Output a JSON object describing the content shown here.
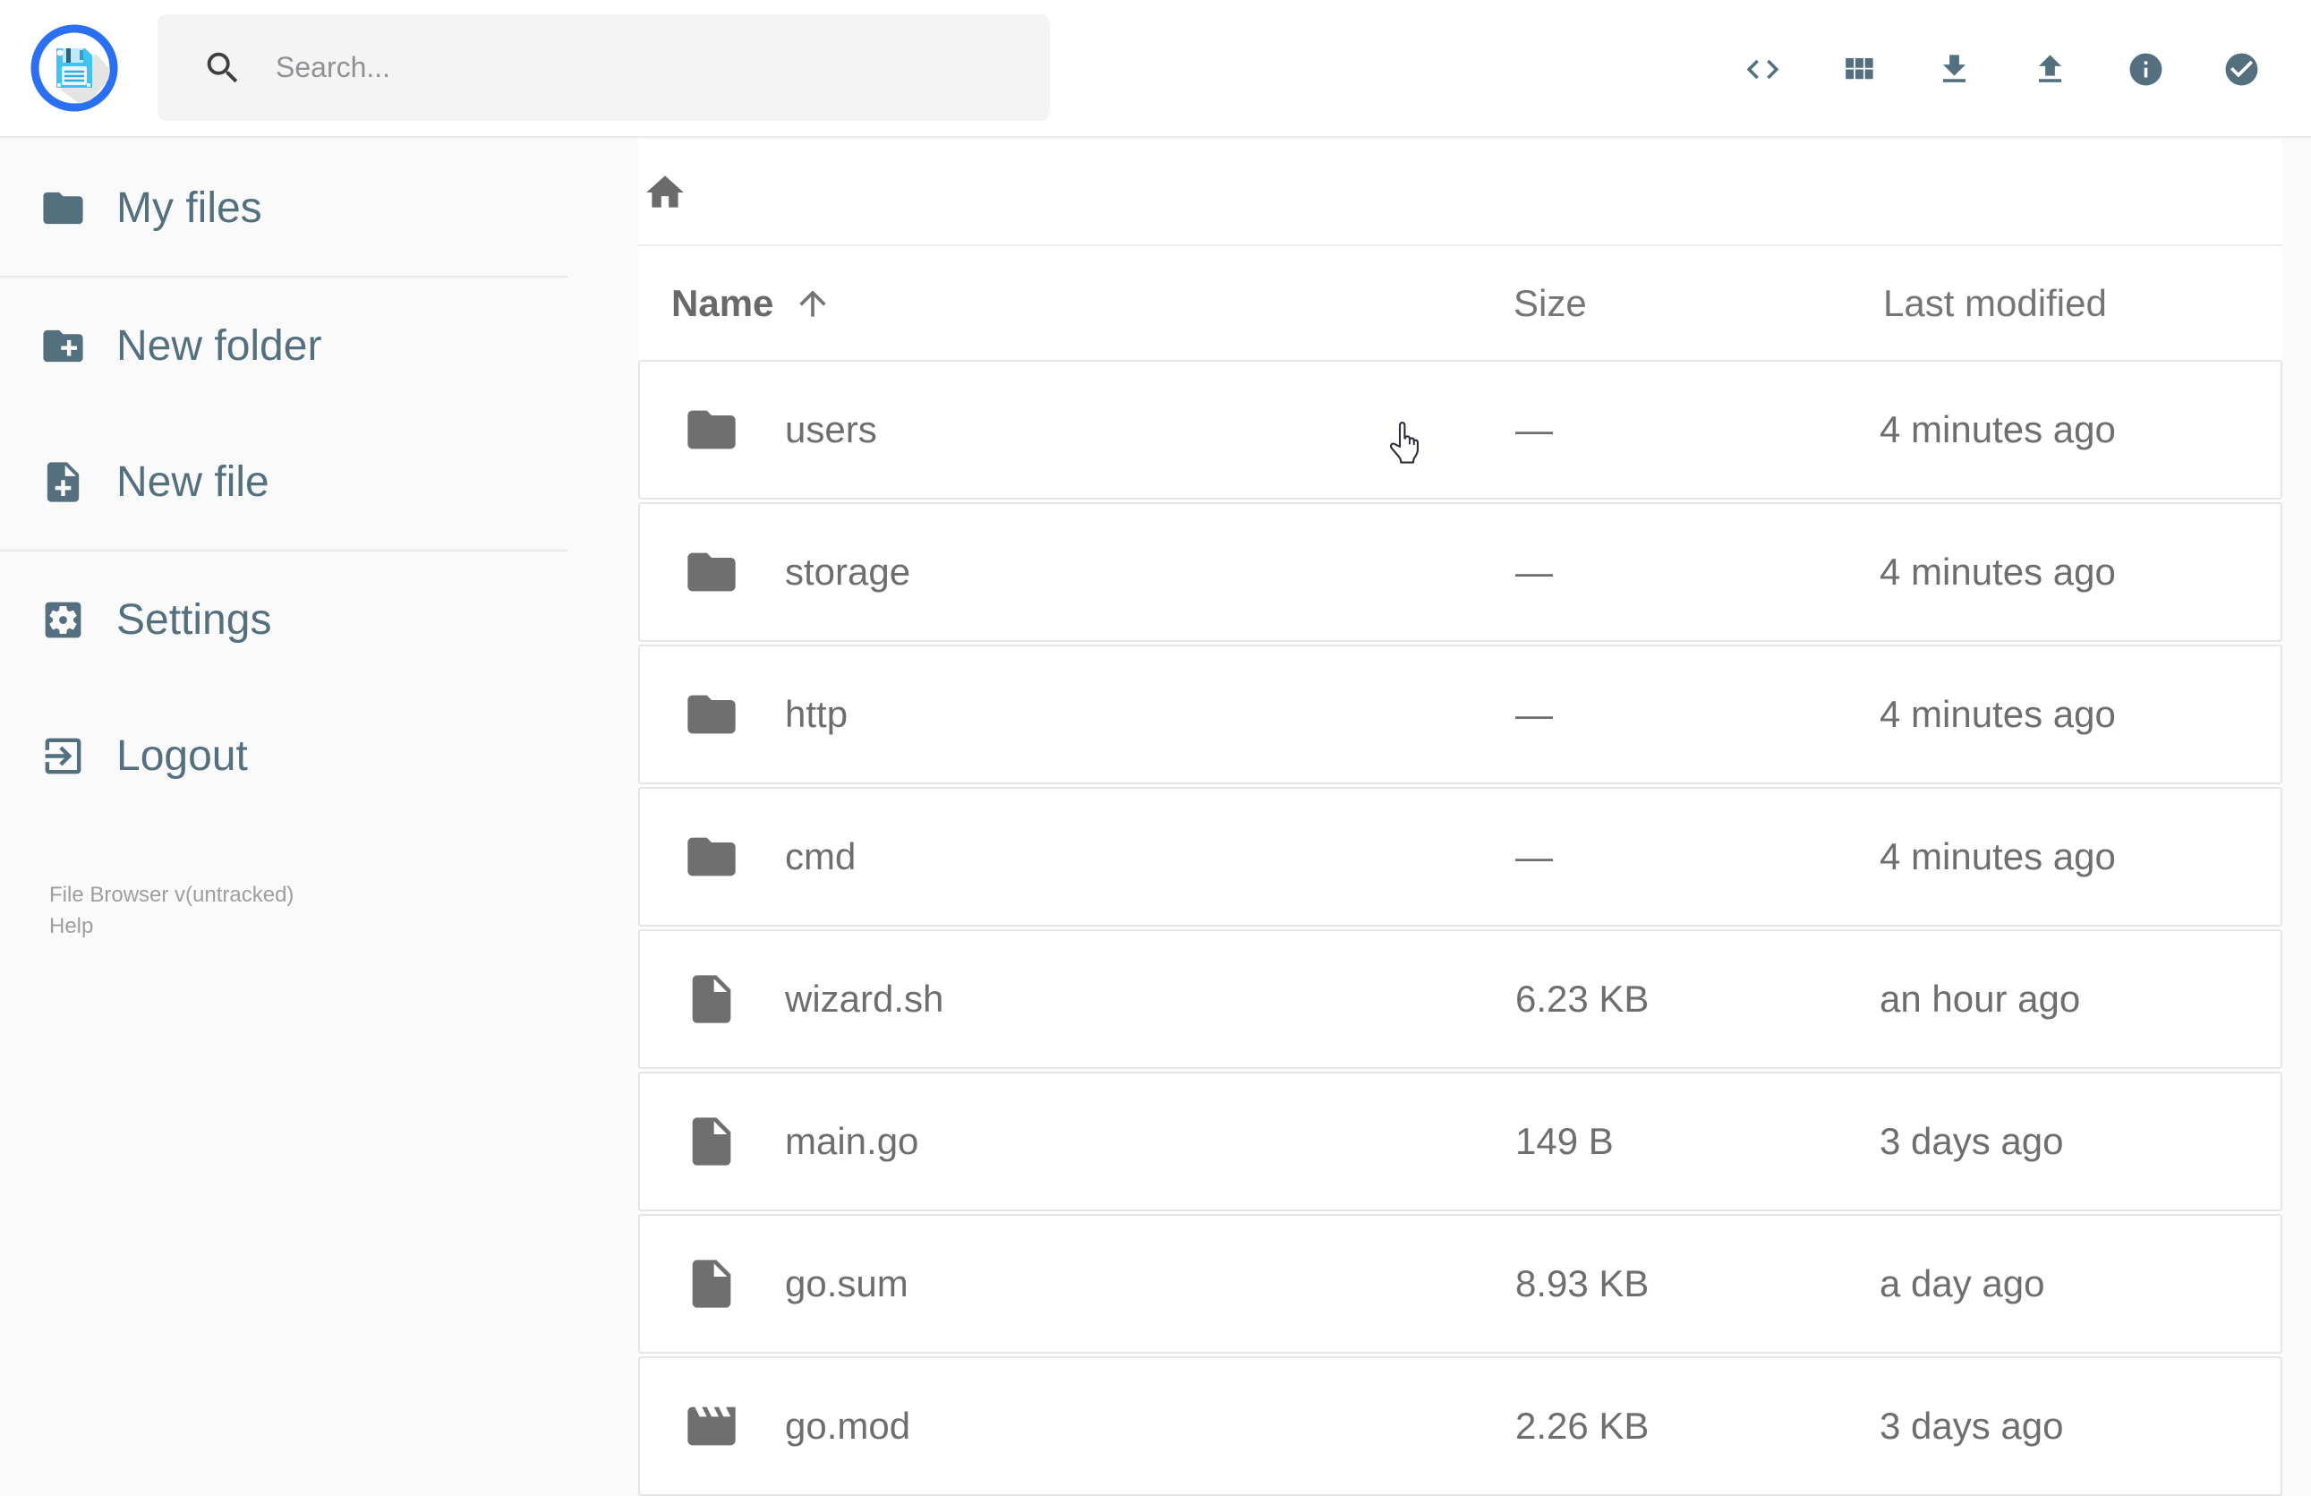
{
  "header": {
    "search": {
      "placeholder": "Search..."
    },
    "actions": [
      {
        "icon": "code-icon"
      },
      {
        "icon": "grid-view-icon"
      },
      {
        "icon": "download-icon"
      },
      {
        "icon": "upload-icon"
      },
      {
        "icon": "info-icon"
      },
      {
        "icon": "check-circle-icon"
      }
    ]
  },
  "sidebar": {
    "items": [
      {
        "label": "My files",
        "icon": "folder-icon"
      },
      {
        "label": "New folder",
        "icon": "folder-plus-icon"
      },
      {
        "label": "New file",
        "icon": "file-plus-icon"
      },
      {
        "label": "Settings",
        "icon": "gear-icon"
      },
      {
        "label": "Logout",
        "icon": "logout-icon"
      }
    ],
    "footer": {
      "version": "File Browser v(untracked)",
      "help": "Help"
    }
  },
  "breadcrumb": {
    "home": "home-icon"
  },
  "listing": {
    "columns": {
      "name": "Name",
      "size": "Size",
      "modified": "Last modified"
    },
    "sort": {
      "column": "name",
      "direction": "asc"
    },
    "rows": [
      {
        "name": "users",
        "type": "folder",
        "size": "—",
        "modified": "4 minutes ago"
      },
      {
        "name": "storage",
        "type": "folder",
        "size": "—",
        "modified": "4 minutes ago"
      },
      {
        "name": "http",
        "type": "folder",
        "size": "—",
        "modified": "4 minutes ago"
      },
      {
        "name": "cmd",
        "type": "folder",
        "size": "—",
        "modified": "4 minutes ago"
      },
      {
        "name": "wizard.sh",
        "type": "file",
        "size": "6.23 KB",
        "modified": "an hour ago"
      },
      {
        "name": "main.go",
        "type": "file",
        "size": "149 B",
        "modified": "3 days ago"
      },
      {
        "name": "go.sum",
        "type": "file",
        "size": "8.93 KB",
        "modified": "a day ago"
      },
      {
        "name": "go.mod",
        "type": "movie",
        "size": "2.26 KB",
        "modified": "3 days ago"
      }
    ]
  },
  "colors": {
    "accent_blue": "#2b6ff2",
    "logo_blue": "#3fc3f2",
    "slate": "#54707e",
    "row_gray": "#6e6e6e",
    "page_bg": "#fafafa",
    "divider": "#e9e9e9"
  }
}
